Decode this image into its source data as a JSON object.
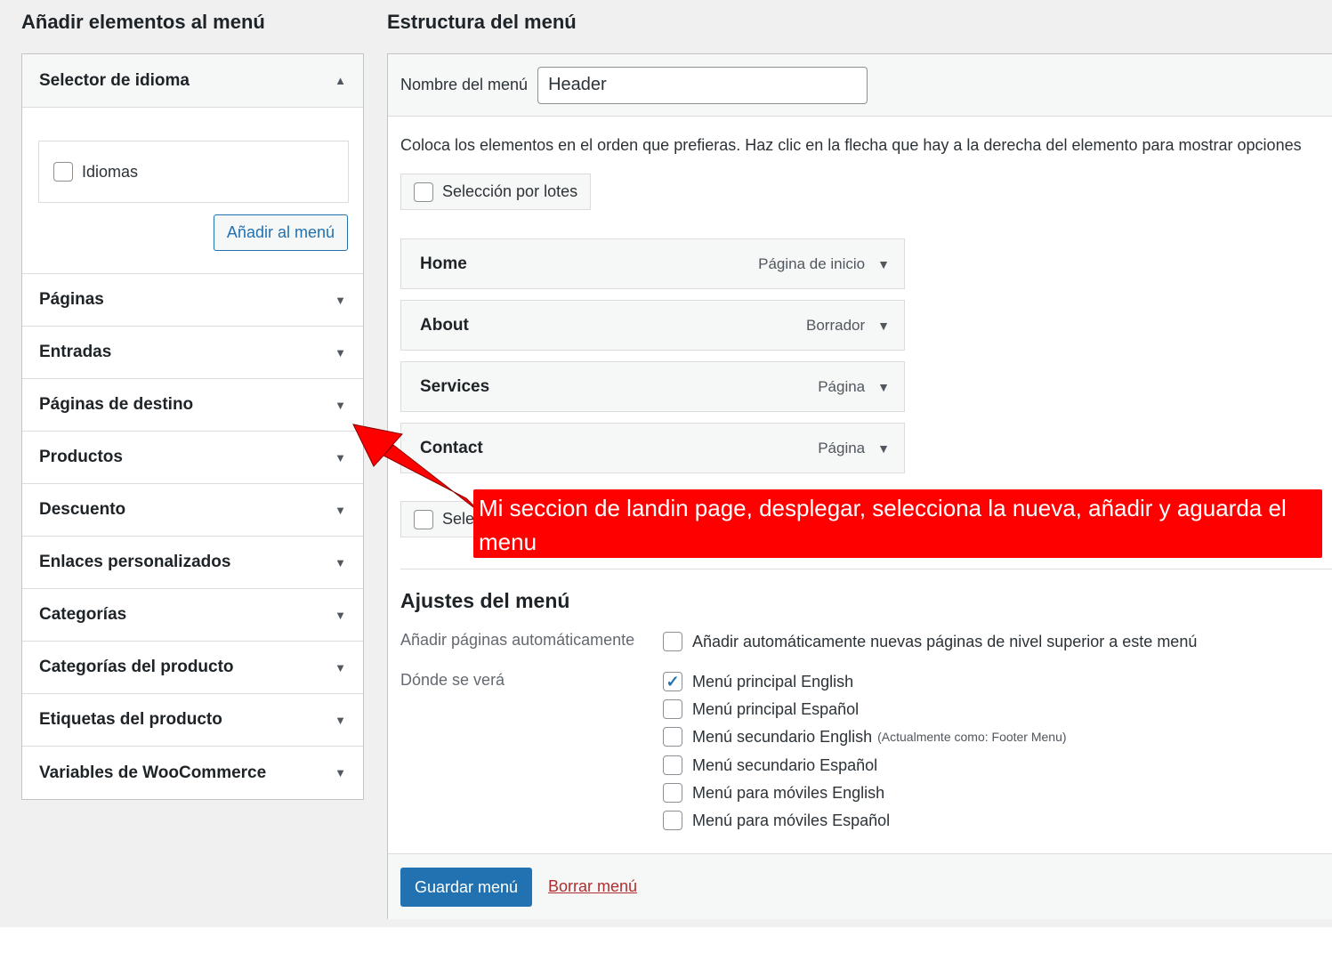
{
  "left_column": {
    "title": "Añadir elementos al menú",
    "language_selector": {
      "title": "Selector de idioma",
      "option": "Idiomas",
      "add_button": "Añadir al menú"
    },
    "sections": [
      "Páginas",
      "Entradas",
      "Páginas de destino",
      "Productos",
      "Descuento",
      "Enlaces personalizados",
      "Categorías",
      "Categorías del producto",
      "Etiquetas del producto",
      "Variables de WooCommerce"
    ]
  },
  "right_column": {
    "title": "Estructura del menú",
    "menu_name_label": "Nombre del menú",
    "menu_name_value": "Header",
    "instructions": "Coloca los elementos en el orden que prefieras. Haz clic en la flecha que hay a la derecha del elemento para mostrar opciones",
    "bulk_select": "Selección por lotes",
    "bulk_select_bottom": "Sele",
    "menu_items": [
      {
        "title": "Home",
        "type": "Página de inicio"
      },
      {
        "title": "About",
        "type": "Borrador"
      },
      {
        "title": "Services",
        "type": "Página"
      },
      {
        "title": "Contact",
        "type": "Página"
      }
    ],
    "settings": {
      "title": "Ajustes del menú",
      "auto_add_label": "Añadir páginas automáticamente",
      "auto_add_option": "Añadir automáticamente nuevas páginas de nivel superior a este menú",
      "locations_label": "Dónde se verá",
      "locations": [
        {
          "label": "Menú principal English",
          "checked": true,
          "note": ""
        },
        {
          "label": "Menú principal Español",
          "checked": false,
          "note": ""
        },
        {
          "label": "Menú secundario English",
          "checked": false,
          "note": "(Actualmente como: Footer Menu)"
        },
        {
          "label": "Menú secundario Español",
          "checked": false,
          "note": ""
        },
        {
          "label": "Menú para móviles English",
          "checked": false,
          "note": ""
        },
        {
          "label": "Menú para móviles Español",
          "checked": false,
          "note": ""
        }
      ]
    },
    "save_button": "Guardar menú",
    "delete_link": "Borrar menú"
  },
  "annotation": {
    "text": "Mi seccion de landin page, desplegar, selecciona la nueva, añadir y aguarda el menu",
    "color": "#ff0000"
  },
  "icons": {
    "arrow_up": "▲",
    "arrow_down": "▼",
    "check": "✓"
  }
}
